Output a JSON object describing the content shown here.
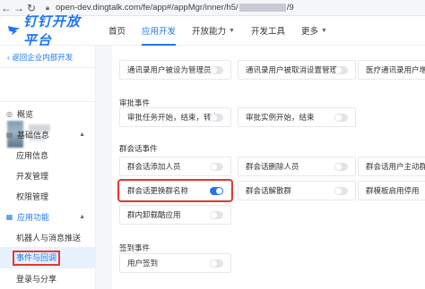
{
  "browser": {
    "url_prefix": "open-dev.dingtalk.com/fe/app#/appMgr/inner/h5/",
    "url_suffix": "/9"
  },
  "header": {
    "logo_text": "钉钉开放平台",
    "nav": [
      {
        "label": "首页"
      },
      {
        "label": "应用开发"
      },
      {
        "label": "开放能力"
      },
      {
        "label": "开发工具"
      },
      {
        "label": "更多"
      }
    ]
  },
  "sidebar": {
    "back_label": "返回企业内部开发",
    "items": {
      "overview": "概览",
      "basic_info": "基础信息",
      "app_info": "应用信息",
      "dev_manage": "开发管理",
      "permission": "权限管理",
      "app_features": "应用功能",
      "robot_push": "机器人与消息推送",
      "events": "事件与回调",
      "login_share": "登录与分享"
    }
  },
  "content": {
    "top_row": [
      {
        "label": "通讯录用户被设为管理员",
        "on": false
      },
      {
        "label": "通讯录用户被取消设置管理员",
        "on": false
      },
      {
        "label": "医疗通讯录用户增",
        "on": false
      }
    ],
    "approval": {
      "title": "审批事件",
      "items": [
        {
          "label": "审批任务开始，结束，转交",
          "on": false
        },
        {
          "label": "审批实例开始，结束",
          "on": false
        }
      ]
    },
    "group": {
      "title": "群会话事件",
      "items": [
        {
          "label": "群会话添加人员",
          "on": false
        },
        {
          "label": "群会话删除人员",
          "on": false
        },
        {
          "label": "群会话用户主动群",
          "on": false
        },
        {
          "label": "群会话更换群名称",
          "on": true
        },
        {
          "label": "群会话解散群",
          "on": false
        },
        {
          "label": "群模板启用停用",
          "on": false
        },
        {
          "label": "群内卸载酷应用",
          "on": false
        }
      ]
    },
    "checkin": {
      "title": "签到事件",
      "items": [
        {
          "label": "用户签到",
          "on": false
        }
      ]
    }
  },
  "colors": {
    "accent": "#1f76f5",
    "highlight": "#e23b2e"
  }
}
